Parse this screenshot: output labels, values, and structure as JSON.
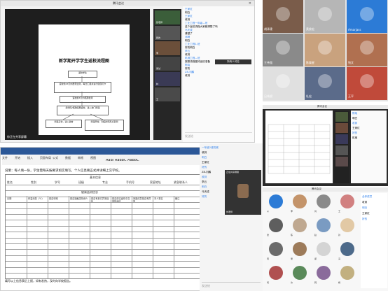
{
  "meeting": {
    "title": "腾讯会议",
    "slide_title": "新学期开学学生返校流程图",
    "flow_steps": [
      "返校学生",
      "返校前15天内居家监测，每日汇报并进行健康打卡",
      "返校前3天内核酸检测",
      "持绿码/核酸结果返校，进入校门测温",
      "测温正常，进入宿舍",
      "测温异常，到临时隔离点复测"
    ],
    "share_label": "你正在共享屏幕",
    "video_labels": [
      "张老师",
      "我的",
      "李",
      "测试",
      "林",
      "王"
    ],
    "chat": [
      {
        "name": "王家红",
        "text": "明白"
      },
      {
        "name": "王家红",
        "text": "收到"
      },
      {
        "name": "工业工程一年级—班",
        "text": "这个返校流程大家都清楚了吗"
      },
      {
        "name": "马天成",
        "text": "清楚了"
      },
      {
        "name": "邓晴",
        "text": "明白"
      },
      {
        "name": "工业工程1-班",
        "text": "好的明白"
      },
      {
        "name": "李云",
        "text": "收到"
      },
      {
        "name": "机械工程—班",
        "text": "按照流程做好返校准备"
      },
      {
        "name": "陈晓",
        "text": "好的"
      },
      {
        "name": "Z8-刘鹏",
        "text": "收到"
      }
    ],
    "chat_input_placeholder": "发送给",
    "chat_tooltip": "所有人可见"
  },
  "gallery": {
    "names": [
      "胡泽建",
      "黄俊宏",
      "Amarjass",
      "王伟强",
      "陈泰星",
      "钱文",
      "吕伟斌",
      "杜宏",
      "王平"
    ],
    "colors": [
      "#7a5c4a",
      "#b6b6b6",
      "#2c7bd6",
      "#8a8a8a",
      "#c9a27e",
      "#b07050",
      "#e0e0e0",
      "#5b6b8a",
      "#c04a3a"
    ]
  },
  "sheet": {
    "toolbar_labels": [
      "文件",
      "开始",
      "插入",
      "页面布局",
      "公式",
      "数据",
      "审阅",
      "视图"
    ],
    "style_gallery": "AaBl AaBbC AaBbC",
    "instruction": "说明：每人填一份，学生需每天按要求如实填写，个人信息要正式并详细上交学校。",
    "header_title": "基本信息",
    "columns": [
      "姓名",
      "性别",
      "学号",
      "班级",
      "专业",
      "手机号",
      "家庭地址",
      "紧急联系人"
    ],
    "subheader": "健康监测信息",
    "row_headers": [
      "日期",
      "体温测量（℃）",
      "是否咳嗽",
      "是否接触发热病人",
      "是否有其它异常症状",
      "是否前往疫情中高风险地区",
      "家庭成员是否有异常",
      "本人签名",
      "备注"
    ],
    "footer_note": "填写以上信息表后上报，如有发热，及时向学校报告。"
  },
  "chat_panel": {
    "items": [
      "一年级2班机械",
      "收到",
      "明白",
      "王家红",
      "好的",
      "Z8-刘鹏",
      "收到",
      "李云",
      "明白",
      "马天成",
      "好的"
    ],
    "input_placeholder": "发送给"
  },
  "video_call": {
    "title": "腾讯会议",
    "labels": [
      "正在共享屏幕",
      "刘老师"
    ],
    "chat_items": [
      "陈晓",
      "明白",
      "收到",
      "王家红",
      "好的",
      "机械"
    ]
  },
  "meeting2": {
    "title": "腾讯会议",
    "participants": [
      "LJ",
      "李",
      "刘",
      "王",
      "张",
      "陈",
      "赵",
      "孙",
      "周",
      "吴",
      "郑",
      "冯",
      "何",
      "许",
      "韩",
      "杨"
    ],
    "colors": [
      "#2c7bd6",
      "#c4946a",
      "#8a8a8a",
      "#d18080",
      "#5e5e5e",
      "#bfa890",
      "#7a9bc2",
      "#e2c9a5",
      "#6b6b6b",
      "#9d7b5a",
      "#d4d4d4",
      "#4d6a8a",
      "#b05050",
      "#5a8a5a",
      "#8a6b9b",
      "#c2b080"
    ],
    "chat": [
      "全体成员",
      "收到",
      "明白",
      "王家红",
      "好的"
    ]
  }
}
